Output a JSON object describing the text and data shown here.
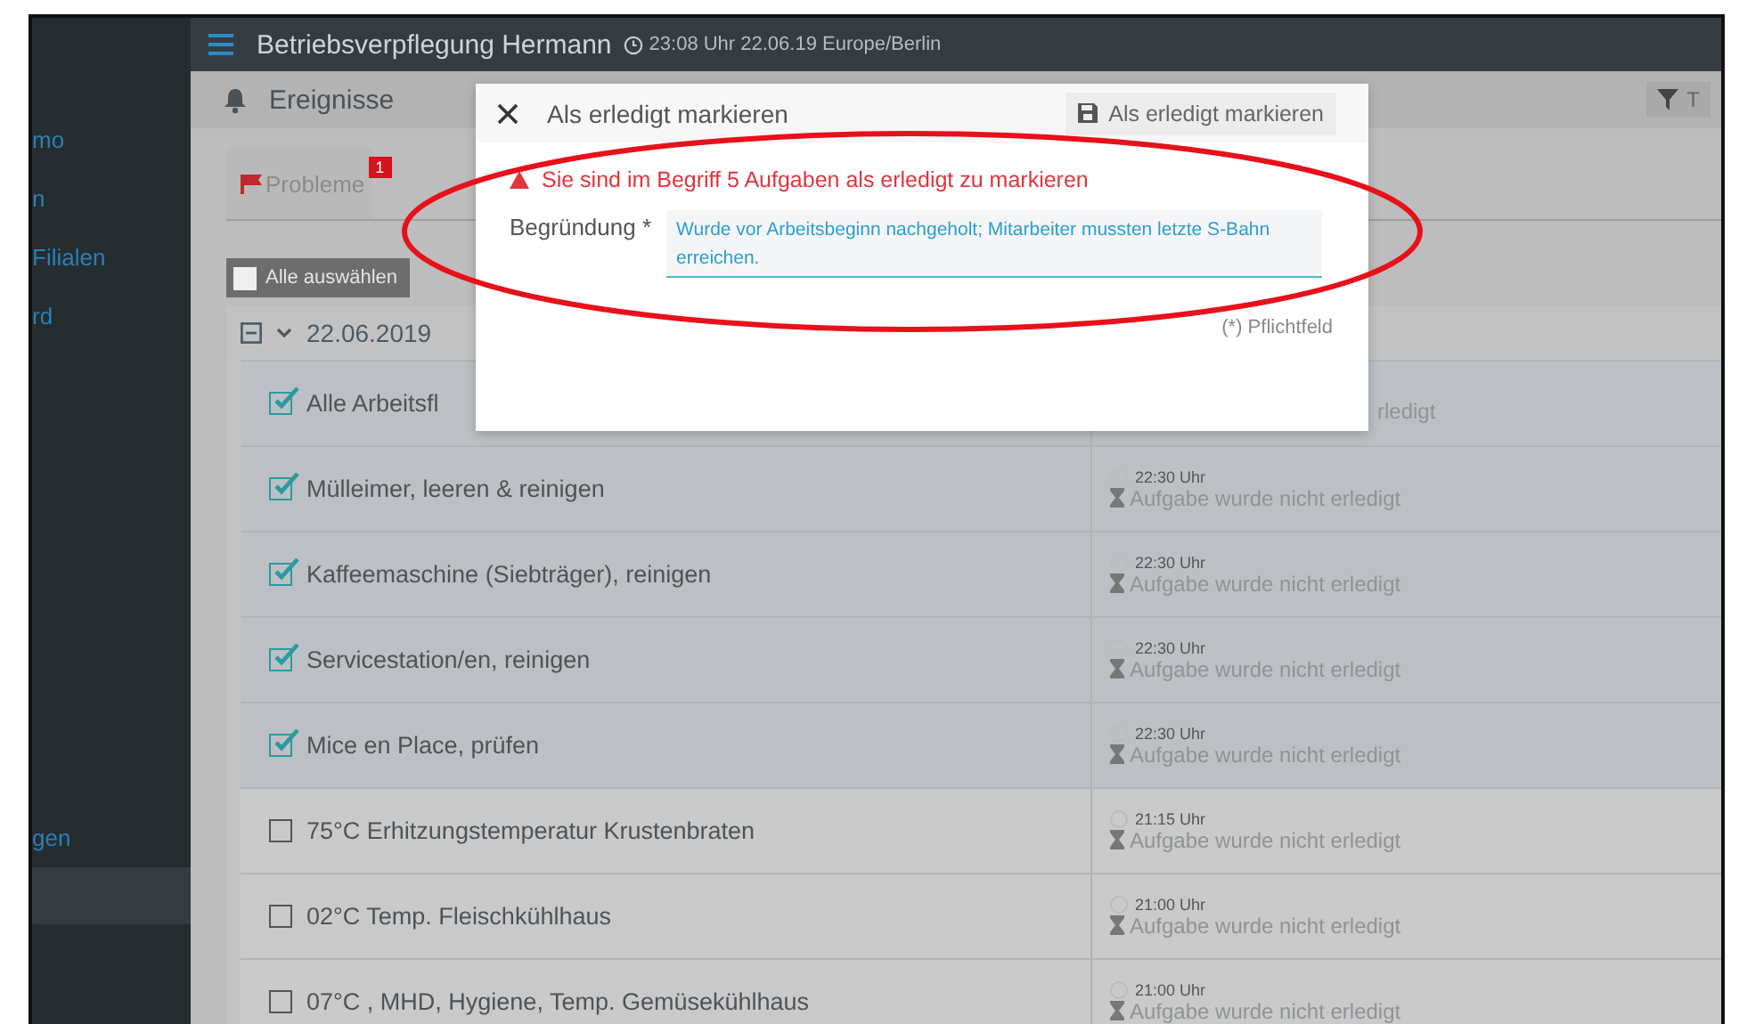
{
  "topbar": {
    "title": "Betriebsverpflegung Hermann",
    "clock": "23:08 Uhr 22.06.19 Europe/Berlin"
  },
  "sidebar": {
    "items": [
      {
        "label": "mo",
        "selected": false
      },
      {
        "label": "n",
        "selected": false
      },
      {
        "label": "Filialen",
        "selected": false
      },
      {
        "label": "rd",
        "selected": false
      },
      {
        "label": "gen",
        "selected": false
      },
      {
        "selected": true
      }
    ]
  },
  "section": {
    "title": "Ereignisse",
    "filter_label": "T"
  },
  "tabs": [
    {
      "label": "Probleme",
      "badge": "1",
      "selected": false
    }
  ],
  "toolbar": {
    "select_all": "Alle auswählen",
    "checked": false
  },
  "group": {
    "date": "22.06.2019",
    "expanded": true
  },
  "rows": [
    {
      "task": "Alle Arbeitsfl",
      "checked": true,
      "status": "rledigt"
    },
    {
      "task": "Mülleimer, leeren & reinigen",
      "checked": true,
      "time": "22:30 Uhr",
      "status": "Aufgabe wurde nicht erledigt"
    },
    {
      "task": "Kaffeemaschine (Siebträger), reinigen",
      "checked": true,
      "time": "22:30 Uhr",
      "status": "Aufgabe wurde nicht erledigt"
    },
    {
      "task": "Servicestation/en, reinigen",
      "checked": true,
      "time": "22:30 Uhr",
      "status": "Aufgabe wurde nicht erledigt"
    },
    {
      "task": "Mice en Place, prüfen",
      "checked": true,
      "time": "22:30 Uhr",
      "status": "Aufgabe wurde nicht erledigt"
    },
    {
      "task": "75°C Erhitzungstemperatur Krustenbraten",
      "checked": false,
      "time": "21:15 Uhr",
      "status": "Aufgabe wurde nicht erledigt"
    },
    {
      "task": "02°C Temp. Fleischkühlhaus",
      "checked": false,
      "time": "21:00 Uhr",
      "status": "Aufgabe wurde nicht erledigt"
    },
    {
      "task": "07°C , MHD, Hygiene, Temp. Gemüsekühlhaus",
      "checked": false,
      "time": "21:00 Uhr",
      "status": "Aufgabe wurde nicht erledigt"
    }
  ],
  "modal": {
    "title": "Als erledigt markieren",
    "save_button": "Als erledigt markieren",
    "warning": "Sie sind im Begriff 5 Aufgaben als erledigt zu markieren",
    "field_label": "Begründung *",
    "field_value": "Wurde vor Arbeitsbeginn nachgeholt; Mitarbeiter mussten letzte S-Bahn erreichen.",
    "required_note": "(*) Pflichtfeld"
  }
}
